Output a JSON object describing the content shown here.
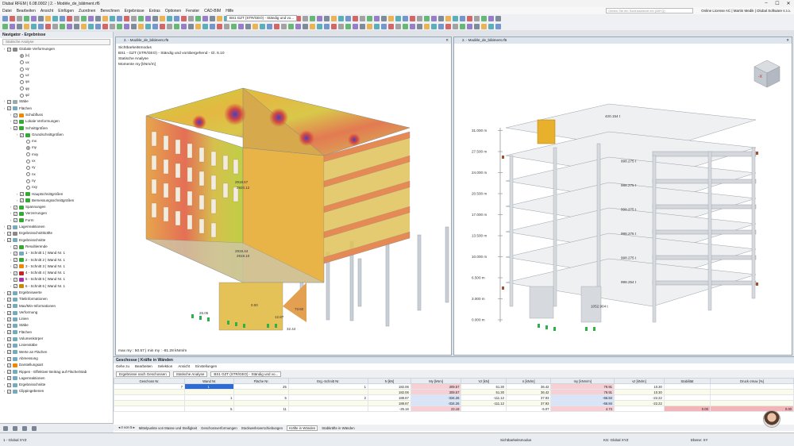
{
  "app": {
    "title": "Dlubal RFEM | 6.08.0002 | 2. - Modèle_de_bâtiment.rf6",
    "min": "–",
    "max": "☐",
    "close": "✕"
  },
  "menu": [
    "Datei",
    "Bearbeiten",
    "Ansicht",
    "Einfügen",
    "Zuordnen",
    "Berechnen",
    "Ergebnisse",
    "Extras",
    "Optionen",
    "Fenster",
    "CAD-BIM",
    "Hilfe"
  ],
  "search_placeholder": "Geben Sie ein Schlüsselwort ein (Alt+Q)",
  "license": "Online License AC | Martin Medik | Dlubal Software s.r.o.",
  "toolbar": {
    "combo_id": "BS1",
    "combo_name": "GZT (STR/GEO) - Ständig und vo..."
  },
  "navigator": {
    "title": "Navigator - Ergebnisse",
    "select": "Statische Analyse",
    "tree": [
      {
        "t": "Globale Verformungen",
        "l": 0,
        "cb": true,
        "c": "#888"
      },
      {
        "t": "|u|",
        "l": 2,
        "radio": true,
        "on": true
      },
      {
        "t": "ux",
        "l": 2,
        "radio": true
      },
      {
        "t": "uy",
        "l": 2,
        "radio": true
      },
      {
        "t": "uz",
        "l": 2,
        "radio": true
      },
      {
        "t": "φx",
        "l": 2,
        "radio": true
      },
      {
        "t": "φy",
        "l": 2,
        "radio": true
      },
      {
        "t": "φz",
        "l": 2,
        "radio": true
      },
      {
        "t": "Stäbe",
        "l": 0,
        "cb": true,
        "c": "#9aa"
      },
      {
        "t": "Flächen",
        "l": 0,
        "cb": true,
        "c": "#7ab"
      },
      {
        "t": "Schubfluss",
        "l": 1,
        "cb": true,
        "c": "#e80"
      },
      {
        "t": "Lokale Verformungen",
        "l": 1,
        "cb": true,
        "c": "#3a3"
      },
      {
        "t": "Schnittgrößen",
        "l": 1,
        "cb": true,
        "c": "#3a3"
      },
      {
        "t": "Grundschnittgrößen",
        "l": 2,
        "cb": true,
        "c": "#3a3"
      },
      {
        "t": "mx",
        "l": 3,
        "radio": true
      },
      {
        "t": "my",
        "l": 3,
        "radio": true,
        "on": true
      },
      {
        "t": "mxy",
        "l": 3,
        "radio": true
      },
      {
        "t": "vx",
        "l": 3,
        "radio": true
      },
      {
        "t": "vy",
        "l": 3,
        "radio": true
      },
      {
        "t": "nx",
        "l": 3,
        "radio": true
      },
      {
        "t": "ny",
        "l": 3,
        "radio": true
      },
      {
        "t": "nxy",
        "l": 3,
        "radio": true
      },
      {
        "t": "Hauptschnittgrößen",
        "l": 2,
        "cb": true,
        "c": "#3a3"
      },
      {
        "t": "Bemessungsschnittgrößen",
        "l": 2,
        "cb": true,
        "c": "#3a3"
      },
      {
        "t": "Spannungen",
        "l": 1,
        "cb": true,
        "c": "#3a3"
      },
      {
        "t": "Verzerrungen",
        "l": 1,
        "cb": true,
        "c": "#3a3"
      },
      {
        "t": "Form",
        "l": 1,
        "cb": true,
        "c": "#3a3"
      },
      {
        "t": "Lagerreaktionen",
        "l": 0,
        "cb": true,
        "c": "#7ab"
      },
      {
        "t": "Ergebnisschnittkräfte",
        "l": 0,
        "cb": true,
        "c": "#888"
      },
      {
        "t": "Ergebnisschnitte",
        "l": 0,
        "cb": true,
        "c": "#7ab"
      },
      {
        "t": "Resultierende",
        "l": 1,
        "cb": true,
        "c": "#3a3"
      },
      {
        "t": "1 - Schnitt 1 | Wand Nr. 1",
        "l": 1,
        "cb": true,
        "c": "#7ab"
      },
      {
        "t": "2 - Schnitt 2 | Wand Nr. 1",
        "l": 1,
        "cb": true,
        "c": "#3a3"
      },
      {
        "t": "3 - Schnitt 3 | Wand Nr. 1",
        "l": 1,
        "cb": true,
        "c": "#e80"
      },
      {
        "t": "4 - Schnitt 4 | Wand Nr. 1",
        "l": 1,
        "cb": true,
        "c": "#c22"
      },
      {
        "t": "5 - Schnitt 5 | Wand Nr. 1",
        "l": 1,
        "cb": true,
        "c": "#a3a"
      },
      {
        "t": "6 - Schnitt 6 | Wand Nr. 1",
        "l": 1,
        "cb": true,
        "c": "#c80"
      },
      {
        "t": "Ergebniswerte",
        "l": 0,
        "cb": true,
        "c": "#7ab"
      },
      {
        "t": "Titelinformationen",
        "l": 0,
        "cb": true,
        "c": "#7ab"
      },
      {
        "t": "Max/Min-Informationen",
        "l": 0,
        "cb": true,
        "c": "#7ab"
      },
      {
        "t": "Verformung",
        "l": 0,
        "cb": true,
        "c": "#7ab"
      },
      {
        "t": "Linien",
        "l": 0,
        "cb": true,
        "c": "#7ab"
      },
      {
        "t": "Stäbe",
        "l": 0,
        "cb": true,
        "c": "#7ab"
      },
      {
        "t": "Flächen",
        "l": 0,
        "cb": true,
        "c": "#7ab"
      },
      {
        "t": "Volumenkörper",
        "l": 0,
        "cb": true,
        "c": "#7ab"
      },
      {
        "t": "Linienstäbe",
        "l": 0,
        "cb": true,
        "c": "#7ab"
      },
      {
        "t": "Werte an Flächen",
        "l": 0,
        "cb": true,
        "c": "#7ab"
      },
      {
        "t": "Abmessung",
        "l": 0,
        "cb": true,
        "c": "#7ab"
      },
      {
        "t": "Darstellungsart",
        "l": 0,
        "cb": true,
        "c": "#e80"
      },
      {
        "t": "Rippen - Effektiver Beitrag auf Fläche/Stab",
        "l": 0,
        "cb": true,
        "c": "#7ab"
      },
      {
        "t": "Lagerreaktionen",
        "l": 0,
        "cb": true,
        "c": "#7ab"
      },
      {
        "t": "Ergebnisschnitte",
        "l": 0,
        "cb": true,
        "c": "#7ab"
      },
      {
        "t": "Clippingebenen",
        "l": 0,
        "cb": true,
        "c": "#7ab"
      }
    ]
  },
  "viewport1": {
    "tab": "2. - Modèle_de_bâtiment.rf6",
    "lines": [
      "Sichtbarkeitsmodus",
      "BS1 - GZT (STR/GEO) - Ständig und vorübergehend - Gl. 6.10",
      "Statische Analyse",
      "Momente my [kNm/m]"
    ],
    "footer": "max my : 50.57 | min my : -81.28 kNm/m",
    "labels": [
      "2918.67",
      "2920.12",
      "2919.44",
      "2919.10",
      "26.05",
      "32.44",
      "12.87",
      "73.82",
      "0.00"
    ]
  },
  "viewport2": {
    "tab": "2. - Modèle_de_bâtiment.rf6",
    "elev": [
      "31.000 m",
      "27.500 m",
      "24.000 m",
      "20.500 m",
      "17.000 m",
      "13.500 m",
      "10.000 m",
      "6.500 m",
      "3.000 m",
      "0.000 m"
    ],
    "slab_labels": [
      "420.154 t",
      "998.275 t",
      "998.275 t",
      "998.275 t",
      "998.275 t",
      "998.275 t",
      "998.254 t",
      "1052.904 t"
    ]
  },
  "grid": {
    "title": "Geschosse | Kräfte in Wänden",
    "menu": [
      "Gehe zu",
      "Bearbeiten",
      "Selektion",
      "Ansicht",
      "Einstellungen"
    ],
    "dd1": "Ergebnisse nach Geschossen",
    "dd2": "Statische Analyse",
    "combo": "BS1   GZT (STR/GEO) - Ständig und vo...",
    "headers": [
      "Geschoss Nr.",
      "Wand Nr.",
      "Fläche Nr.",
      "Erg.-Schnitt Nr.",
      "N [kN]",
      "My [kNm]",
      "Vz [kN]",
      "n [kN/m]",
      "my [kNm/m]",
      "vz [kN/m]",
      "Stabilität",
      "Druck σmax [%]"
    ],
    "group_gesamt": "Gesamtkräfte",
    "group_pro": "Kräfte pro Längeneinheit",
    "rows": [
      [
        "7",
        "1",
        "25",
        "1",
        "182.06",
        "309.57",
        "51.30",
        "36.42",
        "79.91",
        "10.30",
        "",
        ""
      ],
      [
        "",
        "",
        "",
        "",
        "182.06",
        "309.57",
        "51.30",
        "36.42",
        "79.91",
        "10.30",
        "",
        ""
      ],
      [
        "",
        "1",
        "5",
        "2",
        "188.67",
        "-334.26",
        "-111.12",
        "37.93",
        "-66.84",
        "-22.22",
        "",
        ""
      ],
      [
        "",
        "",
        "",
        "",
        "188.67",
        "-334.26",
        "-111.12",
        "37.93",
        "-66.84",
        "-22.22",
        "",
        ""
      ],
      [
        "",
        "5",
        "11",
        "",
        "-25.16",
        "23.18",
        "",
        "-5.07",
        "4.74",
        "",
        "0.00",
        "0.00"
      ]
    ],
    "pager": "4 von 5",
    "tabs": [
      "Mittelpunkte von Masse und Steifigkeit",
      "Geschossverformungen",
      "Stockwerksverschiebungen",
      "Kräfte in Wänden",
      "Stabkräfte in Wänden"
    ],
    "active_tab": "Kräfte in Wänden"
  },
  "status": {
    "view": "1 - Global XYZ",
    "mode": "Sichtbarkeitsmodus",
    "ks": "KS: Global XYZ",
    "plane": "Ebene: XY"
  }
}
